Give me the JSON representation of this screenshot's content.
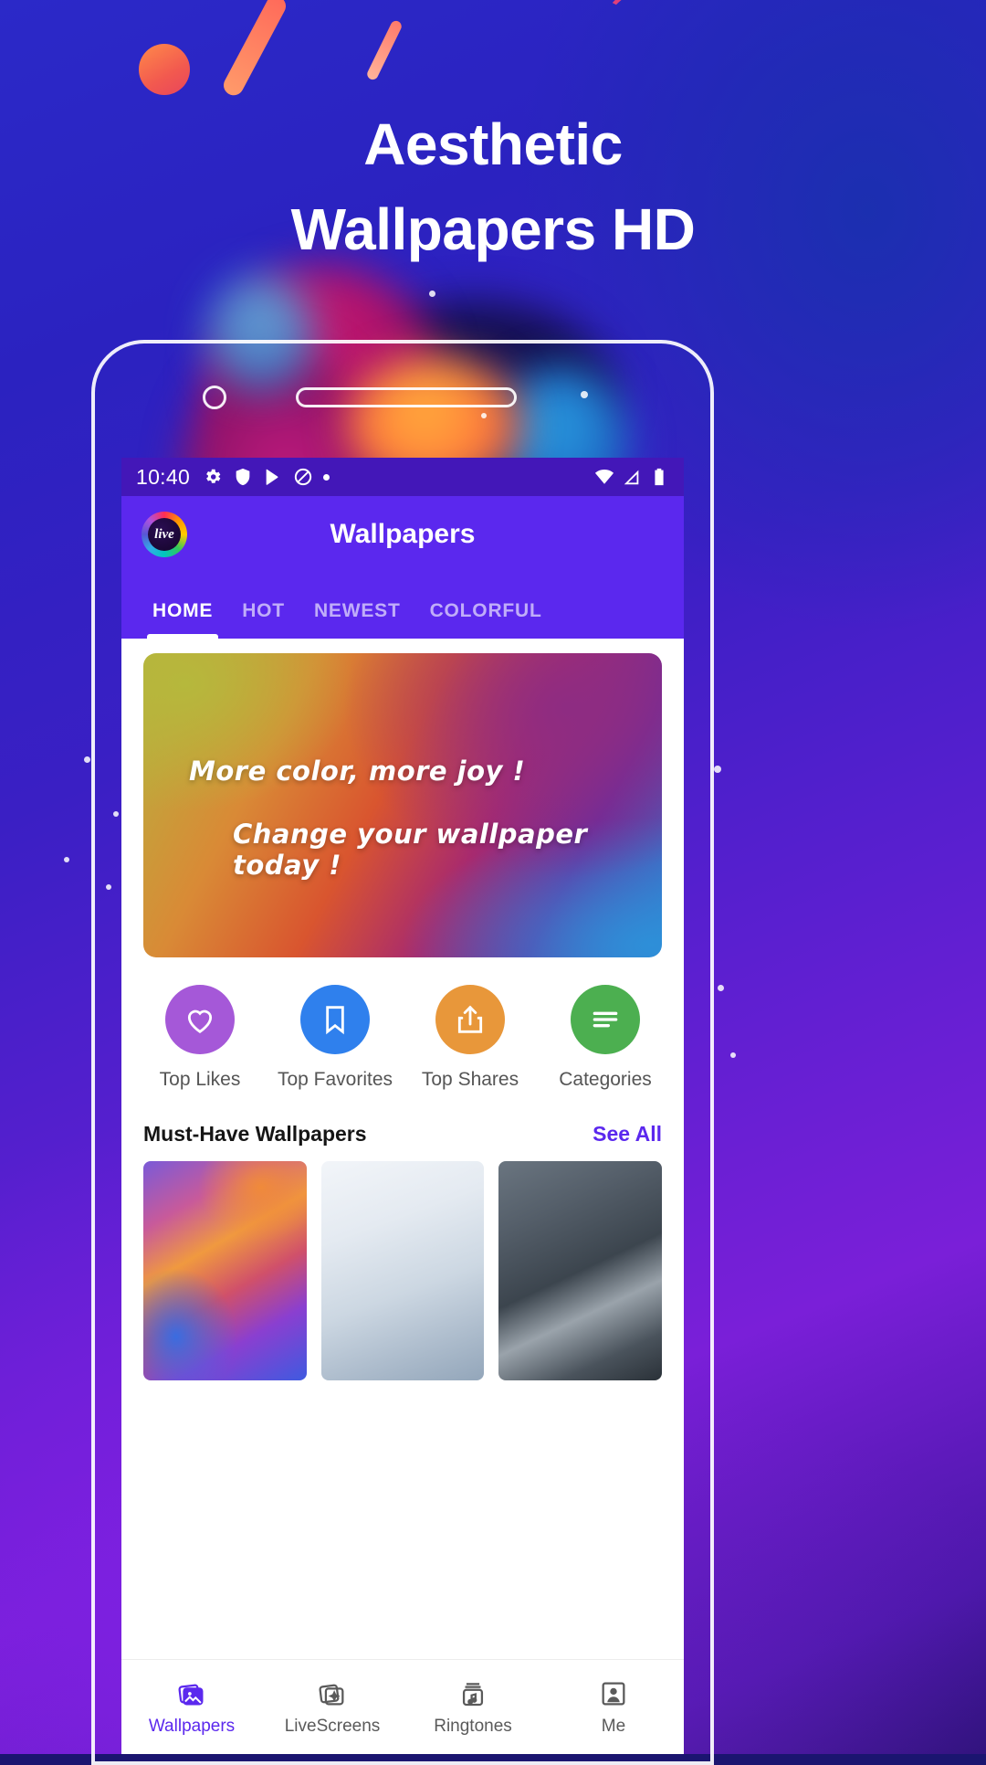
{
  "promo": {
    "title_line1": "Aesthetic",
    "title_line2": "Wallpapers HD"
  },
  "status_bar": {
    "time": "10:40",
    "icons_left": [
      "gear-icon",
      "shield-icon",
      "play-store-icon",
      "do-not-disturb-icon",
      "dot-icon"
    ],
    "icons_right": [
      "wifi-icon",
      "signal-icon",
      "battery-icon"
    ]
  },
  "app_bar": {
    "logo_text": "live",
    "title": "Wallpapers"
  },
  "tabs": [
    {
      "label": "HOME",
      "active": true
    },
    {
      "label": "HOT",
      "active": false
    },
    {
      "label": "NEWEST",
      "active": false
    },
    {
      "label": "COLORFUL",
      "active": false
    }
  ],
  "hero_banner": {
    "line1": "More color, more joy !",
    "line2": "Change your wallpaper today !"
  },
  "quick_actions": [
    {
      "label": "Top Likes",
      "icon": "heart-icon",
      "color": "#a558d8"
    },
    {
      "label": "Top Favorites",
      "icon": "bookmark-icon",
      "color": "#2f80ed"
    },
    {
      "label": "Top Shares",
      "icon": "share-icon",
      "color": "#e8973a"
    },
    {
      "label": "Categories",
      "icon": "list-icon",
      "color": "#4caf50"
    }
  ],
  "section": {
    "title": "Must-Have Wallpapers",
    "see_all": "See All"
  },
  "thumbnails": [
    {
      "name": "wallpaper-thumb-1"
    },
    {
      "name": "wallpaper-thumb-2"
    },
    {
      "name": "wallpaper-thumb-3"
    }
  ],
  "bottom_nav": [
    {
      "label": "Wallpapers",
      "icon": "images-icon",
      "active": true
    },
    {
      "label": "LiveScreens",
      "icon": "live-screens-icon",
      "active": false
    },
    {
      "label": "Ringtones",
      "icon": "ringtone-icon",
      "active": false
    },
    {
      "label": "Me",
      "icon": "person-icon",
      "active": false
    }
  ],
  "colors": {
    "brand_purple": "#5b28ee",
    "status_bar": "#4317b8"
  }
}
